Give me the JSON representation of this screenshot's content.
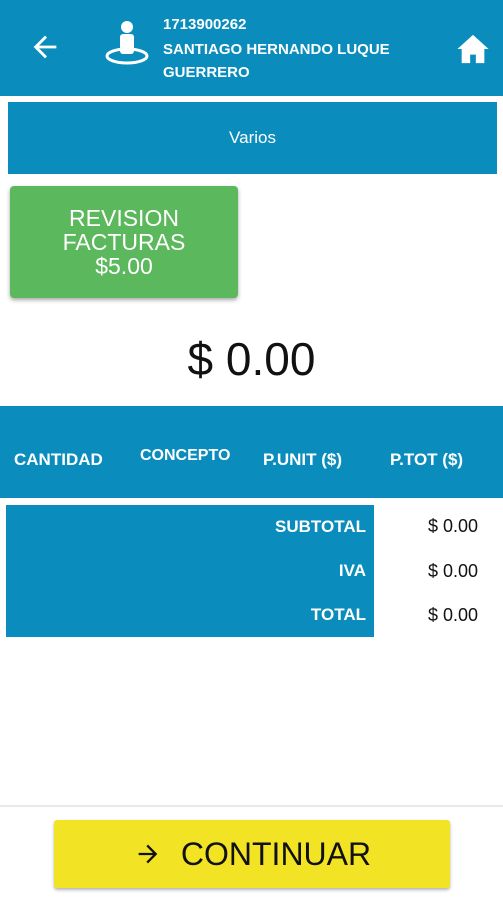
{
  "header": {
    "user_id": "1713900262",
    "user_name": "SANTIAGO HERNANDO LUQUE GUERRERO",
    "back_icon": "arrow-left-icon",
    "user_icon": "user-pin-icon",
    "home_icon": "home-icon"
  },
  "category": {
    "label": "Varios"
  },
  "products": [
    {
      "name_line1": "REVISION",
      "name_line2": "FACTURAS",
      "price": "$5.00"
    }
  ],
  "total_display": "$ 0.00",
  "table": {
    "columns": [
      "CANTIDAD",
      "CONCEPTO",
      "P.UNIT ($)",
      "P.TOT ($)"
    ],
    "rows": []
  },
  "summary": {
    "subtotal_label": "SUBTOTAL",
    "subtotal_value": "$ 0.00",
    "iva_label": "IVA",
    "iva_value": "$ 0.00",
    "total_label": "TOTAL",
    "total_value": "$ 0.00"
  },
  "footer": {
    "continue_label": "CONTINUAR",
    "continue_icon": "arrow-right-icon"
  },
  "colors": {
    "primary": "#0a8dbd",
    "product": "#5cb85c",
    "cta": "#f2e424"
  }
}
